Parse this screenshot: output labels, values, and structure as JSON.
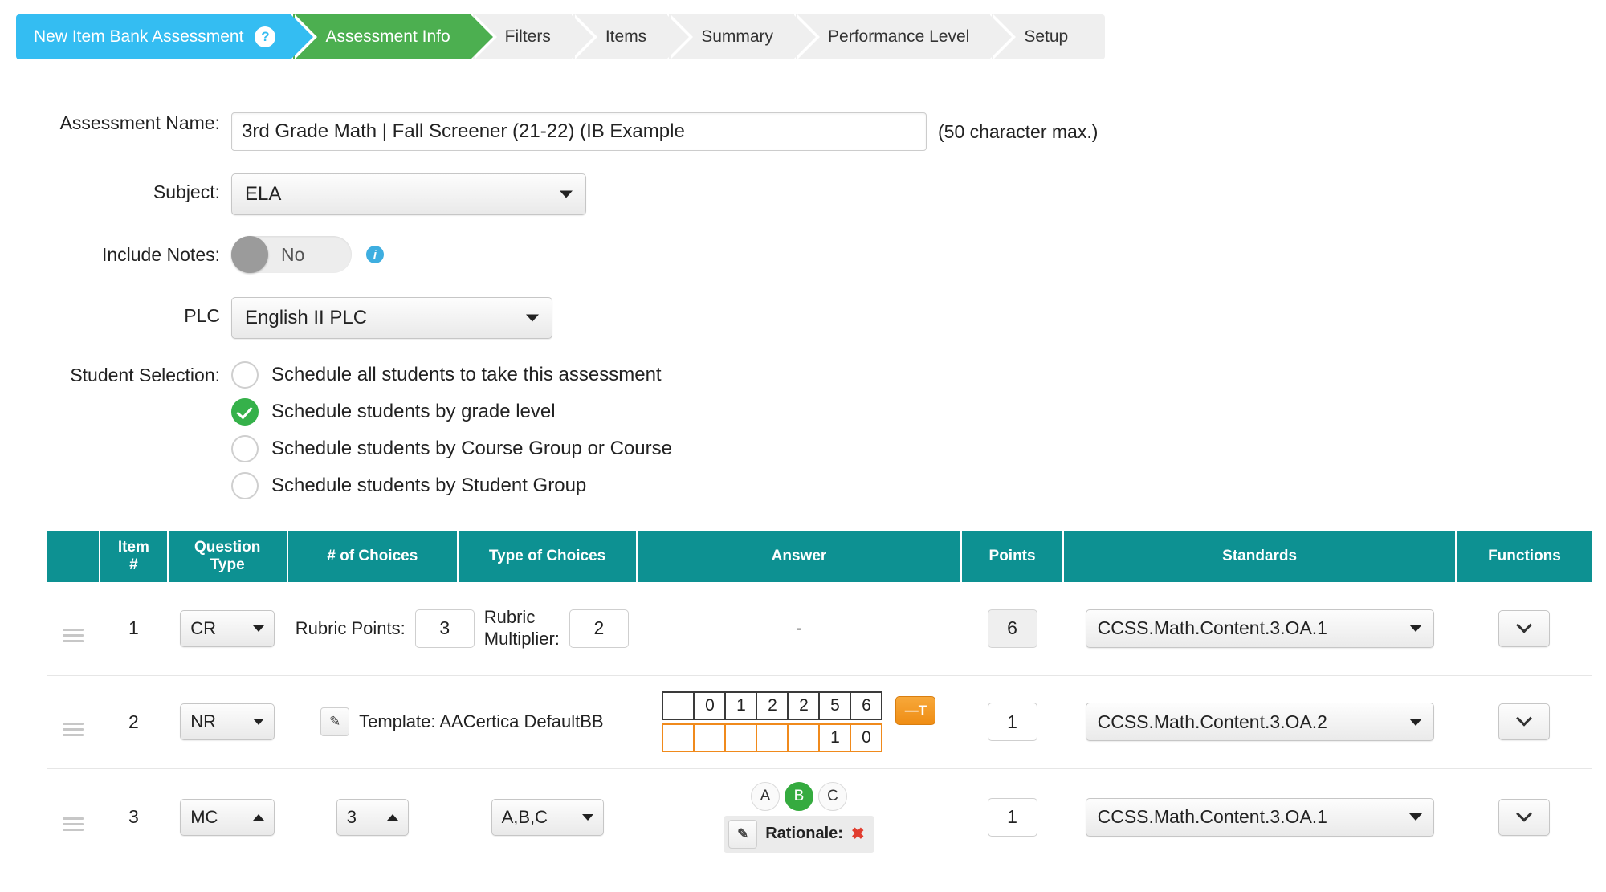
{
  "wizard": {
    "steps": [
      {
        "label": "New Item Bank Assessment",
        "state": "current-blue",
        "has_help_icon": true,
        "help_icon": "question-mark-icon"
      },
      {
        "label": "Assessment Info",
        "state": "active-green",
        "has_help_icon": false
      },
      {
        "label": "Filters",
        "state": "inactive",
        "has_help_icon": false
      },
      {
        "label": "Items",
        "state": "inactive",
        "has_help_icon": false
      },
      {
        "label": "Summary",
        "state": "inactive",
        "has_help_icon": false
      },
      {
        "label": "Performance Level",
        "state": "inactive",
        "has_help_icon": false
      },
      {
        "label": "Setup",
        "state": "inactive",
        "has_help_icon": false
      }
    ],
    "colors": {
      "blue": "#34bdf2",
      "green": "#4caf50",
      "inactive": "#efefef"
    }
  },
  "form": {
    "assessment_name": {
      "label": "Assessment Name:",
      "value": "3rd Grade Math | Fall Screener (21-22) (IB Example",
      "placeholder": "",
      "hint": "(50 character max.)"
    },
    "subject": {
      "label": "Subject:",
      "value": "ELA"
    },
    "include_notes": {
      "label": "Include Notes:",
      "value": "No",
      "info_icon": "info-icon"
    },
    "plc": {
      "label": "PLC",
      "value": "English II PLC"
    },
    "student_selection": {
      "label": "Student Selection:",
      "options": [
        {
          "label": "Schedule all students to take this assessment",
          "selected": false
        },
        {
          "label": "Schedule students by grade level",
          "selected": true
        },
        {
          "label": "Schedule students by Course Group or Course",
          "selected": false
        },
        {
          "label": "Schedule students by Student Group",
          "selected": false
        }
      ]
    }
  },
  "table": {
    "headers": [
      {
        "label": ""
      },
      {
        "label": "Item\n#",
        "line1": "Item",
        "line2": "#"
      },
      {
        "label": "Question Type",
        "line1": "Question",
        "line2": "Type"
      },
      {
        "label": "# of Choices"
      },
      {
        "label": "Type of Choices"
      },
      {
        "label": "Answer"
      },
      {
        "label": "Points"
      },
      {
        "label": "Standards"
      },
      {
        "label": "Functions"
      }
    ],
    "header_color": "#0d9192",
    "rows": [
      {
        "item_number": "1",
        "question_type": "CR",
        "question_type_caret": "down",
        "rubric_points_label": "Rubric Points:",
        "rubric_points_value": "3",
        "rubric_multiplier_label_line1": "Rubric",
        "rubric_multiplier_label_line2": "Multiplier:",
        "rubric_multiplier_value": "2",
        "answer_text": "-",
        "points": "6",
        "points_readonly": true,
        "standard": "CCSS.Math.Content.3.OA.1",
        "function_icon": "chevron-down-icon"
      },
      {
        "item_number": "2",
        "question_type": "NR",
        "question_type_caret": "down",
        "template_label": "Template: AACertica DefaultBB",
        "grid_top_row": [
          "",
          "0",
          "1",
          "2",
          "2",
          "5",
          "6"
        ],
        "grid_bottom_row": [
          "",
          "",
          "",
          "",
          "",
          "1",
          "0"
        ],
        "grid_top_border_color": "#3a3a3a",
        "grid_bottom_border_color": "#f08a1c",
        "orange_button_label": "—T",
        "points": "1",
        "points_readonly": false,
        "standard": "CCSS.Math.Content.3.OA.2",
        "function_icon": "chevron-down-icon"
      },
      {
        "item_number": "3",
        "question_type": "MC",
        "question_type_caret": "up",
        "num_choices": "3",
        "num_choices_caret": "up",
        "type_of_choices": "A,B,C",
        "choices": [
          {
            "label": "A",
            "selected": false
          },
          {
            "label": "B",
            "selected": true
          },
          {
            "label": "C",
            "selected": false
          }
        ],
        "rationale_label": "Rationale:",
        "rationale_mark": "✖",
        "points": "1",
        "points_readonly": false,
        "standard": "CCSS.Math.Content.3.OA.1",
        "function_icon": "chevron-down-icon"
      }
    ]
  }
}
